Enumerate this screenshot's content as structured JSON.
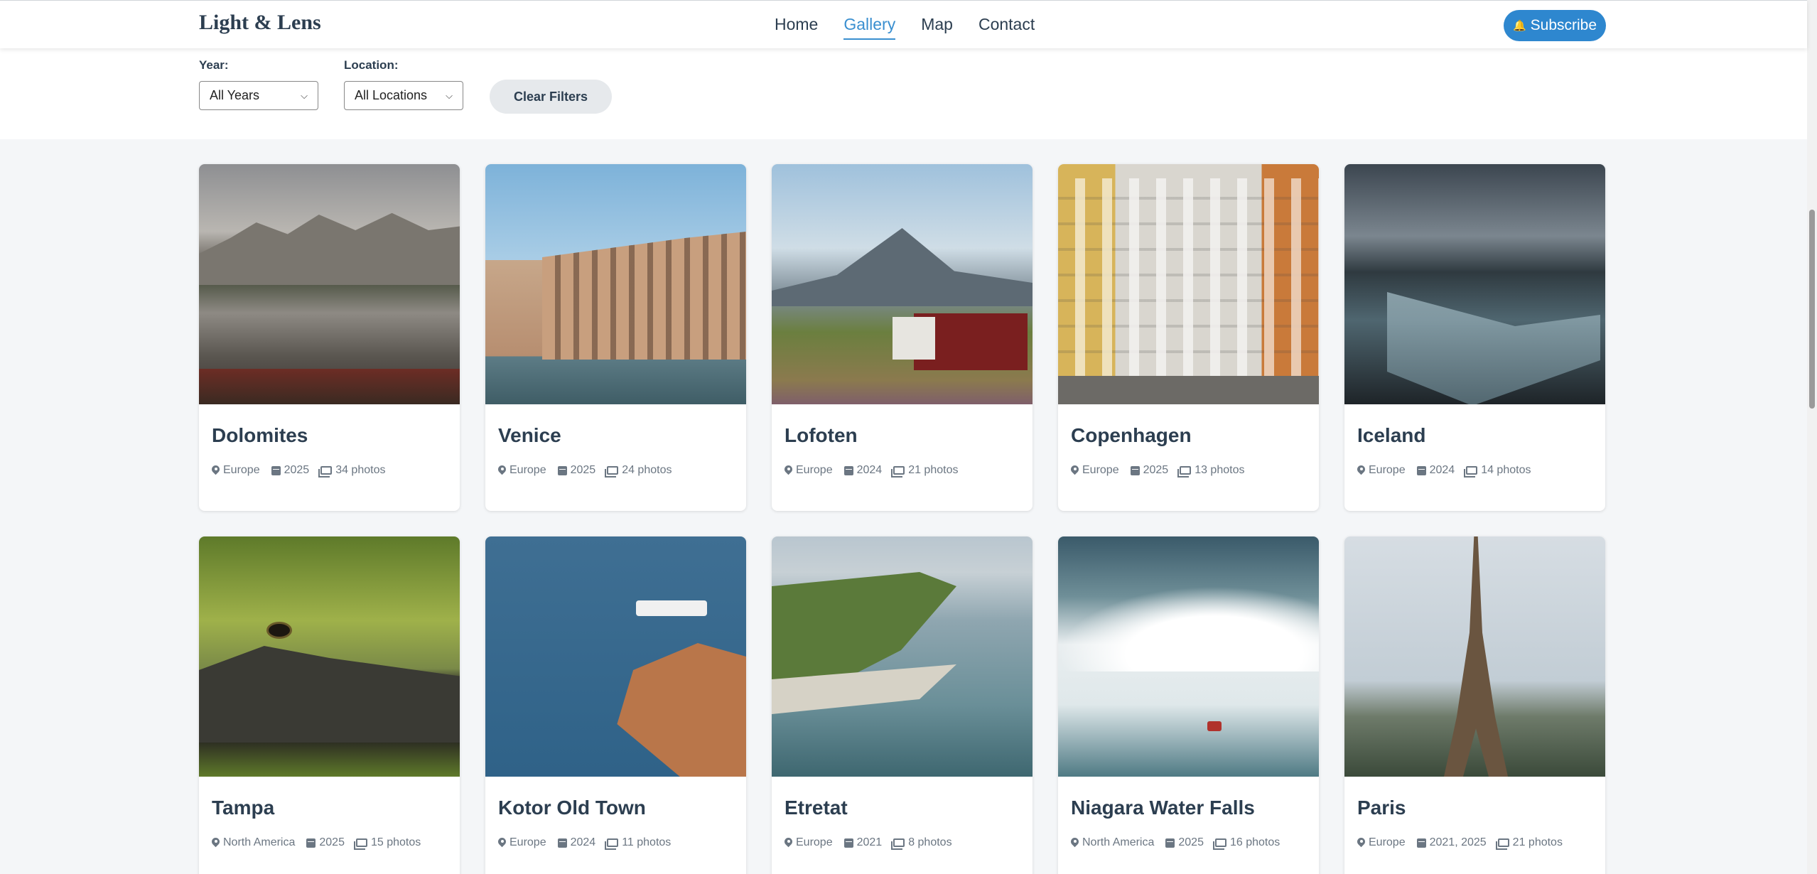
{
  "header": {
    "brand": "Light & Lens",
    "nav": [
      {
        "label": "Home",
        "active": false
      },
      {
        "label": "Gallery",
        "active": true
      },
      {
        "label": "Map",
        "active": false
      },
      {
        "label": "Contact",
        "active": false
      }
    ],
    "subscribe_label": "Subscribe",
    "subscribe_icon": "bell-icon"
  },
  "filters": {
    "year_label": "Year:",
    "year_value": "All Years",
    "location_label": "Location:",
    "location_value": "All Locations",
    "clear_label": "Clear Filters"
  },
  "colors": {
    "accent": "#3a8fd0",
    "subscribe_bg": "#2e87cf",
    "text": "#2c3e50",
    "meta_text": "#6b7682",
    "page_bg": "#f4f6f8"
  },
  "gallery": {
    "albums": [
      {
        "title": "Dolomites",
        "location": "Europe",
        "year": "2025",
        "photos": "34 photos"
      },
      {
        "title": "Venice",
        "location": "Europe",
        "year": "2025",
        "photos": "24 photos"
      },
      {
        "title": "Lofoten",
        "location": "Europe",
        "year": "2024",
        "photos": "21 photos"
      },
      {
        "title": "Copenhagen",
        "location": "Europe",
        "year": "2025",
        "photos": "13 photos"
      },
      {
        "title": "Iceland",
        "location": "Europe",
        "year": "2024",
        "photos": "14 photos"
      },
      {
        "title": "Tampa",
        "location": "North America",
        "year": "2025",
        "photos": "15 photos"
      },
      {
        "title": "Kotor Old Town",
        "location": "Europe",
        "year": "2024",
        "photos": "11 photos"
      },
      {
        "title": "Etretat",
        "location": "Europe",
        "year": "2021",
        "photos": "8 photos"
      },
      {
        "title": "Niagara Water Falls",
        "location": "North America",
        "year": "2025",
        "photos": "16 photos"
      },
      {
        "title": "Paris",
        "location": "Europe",
        "year": "2021, 2025",
        "photos": "21 photos"
      }
    ]
  }
}
